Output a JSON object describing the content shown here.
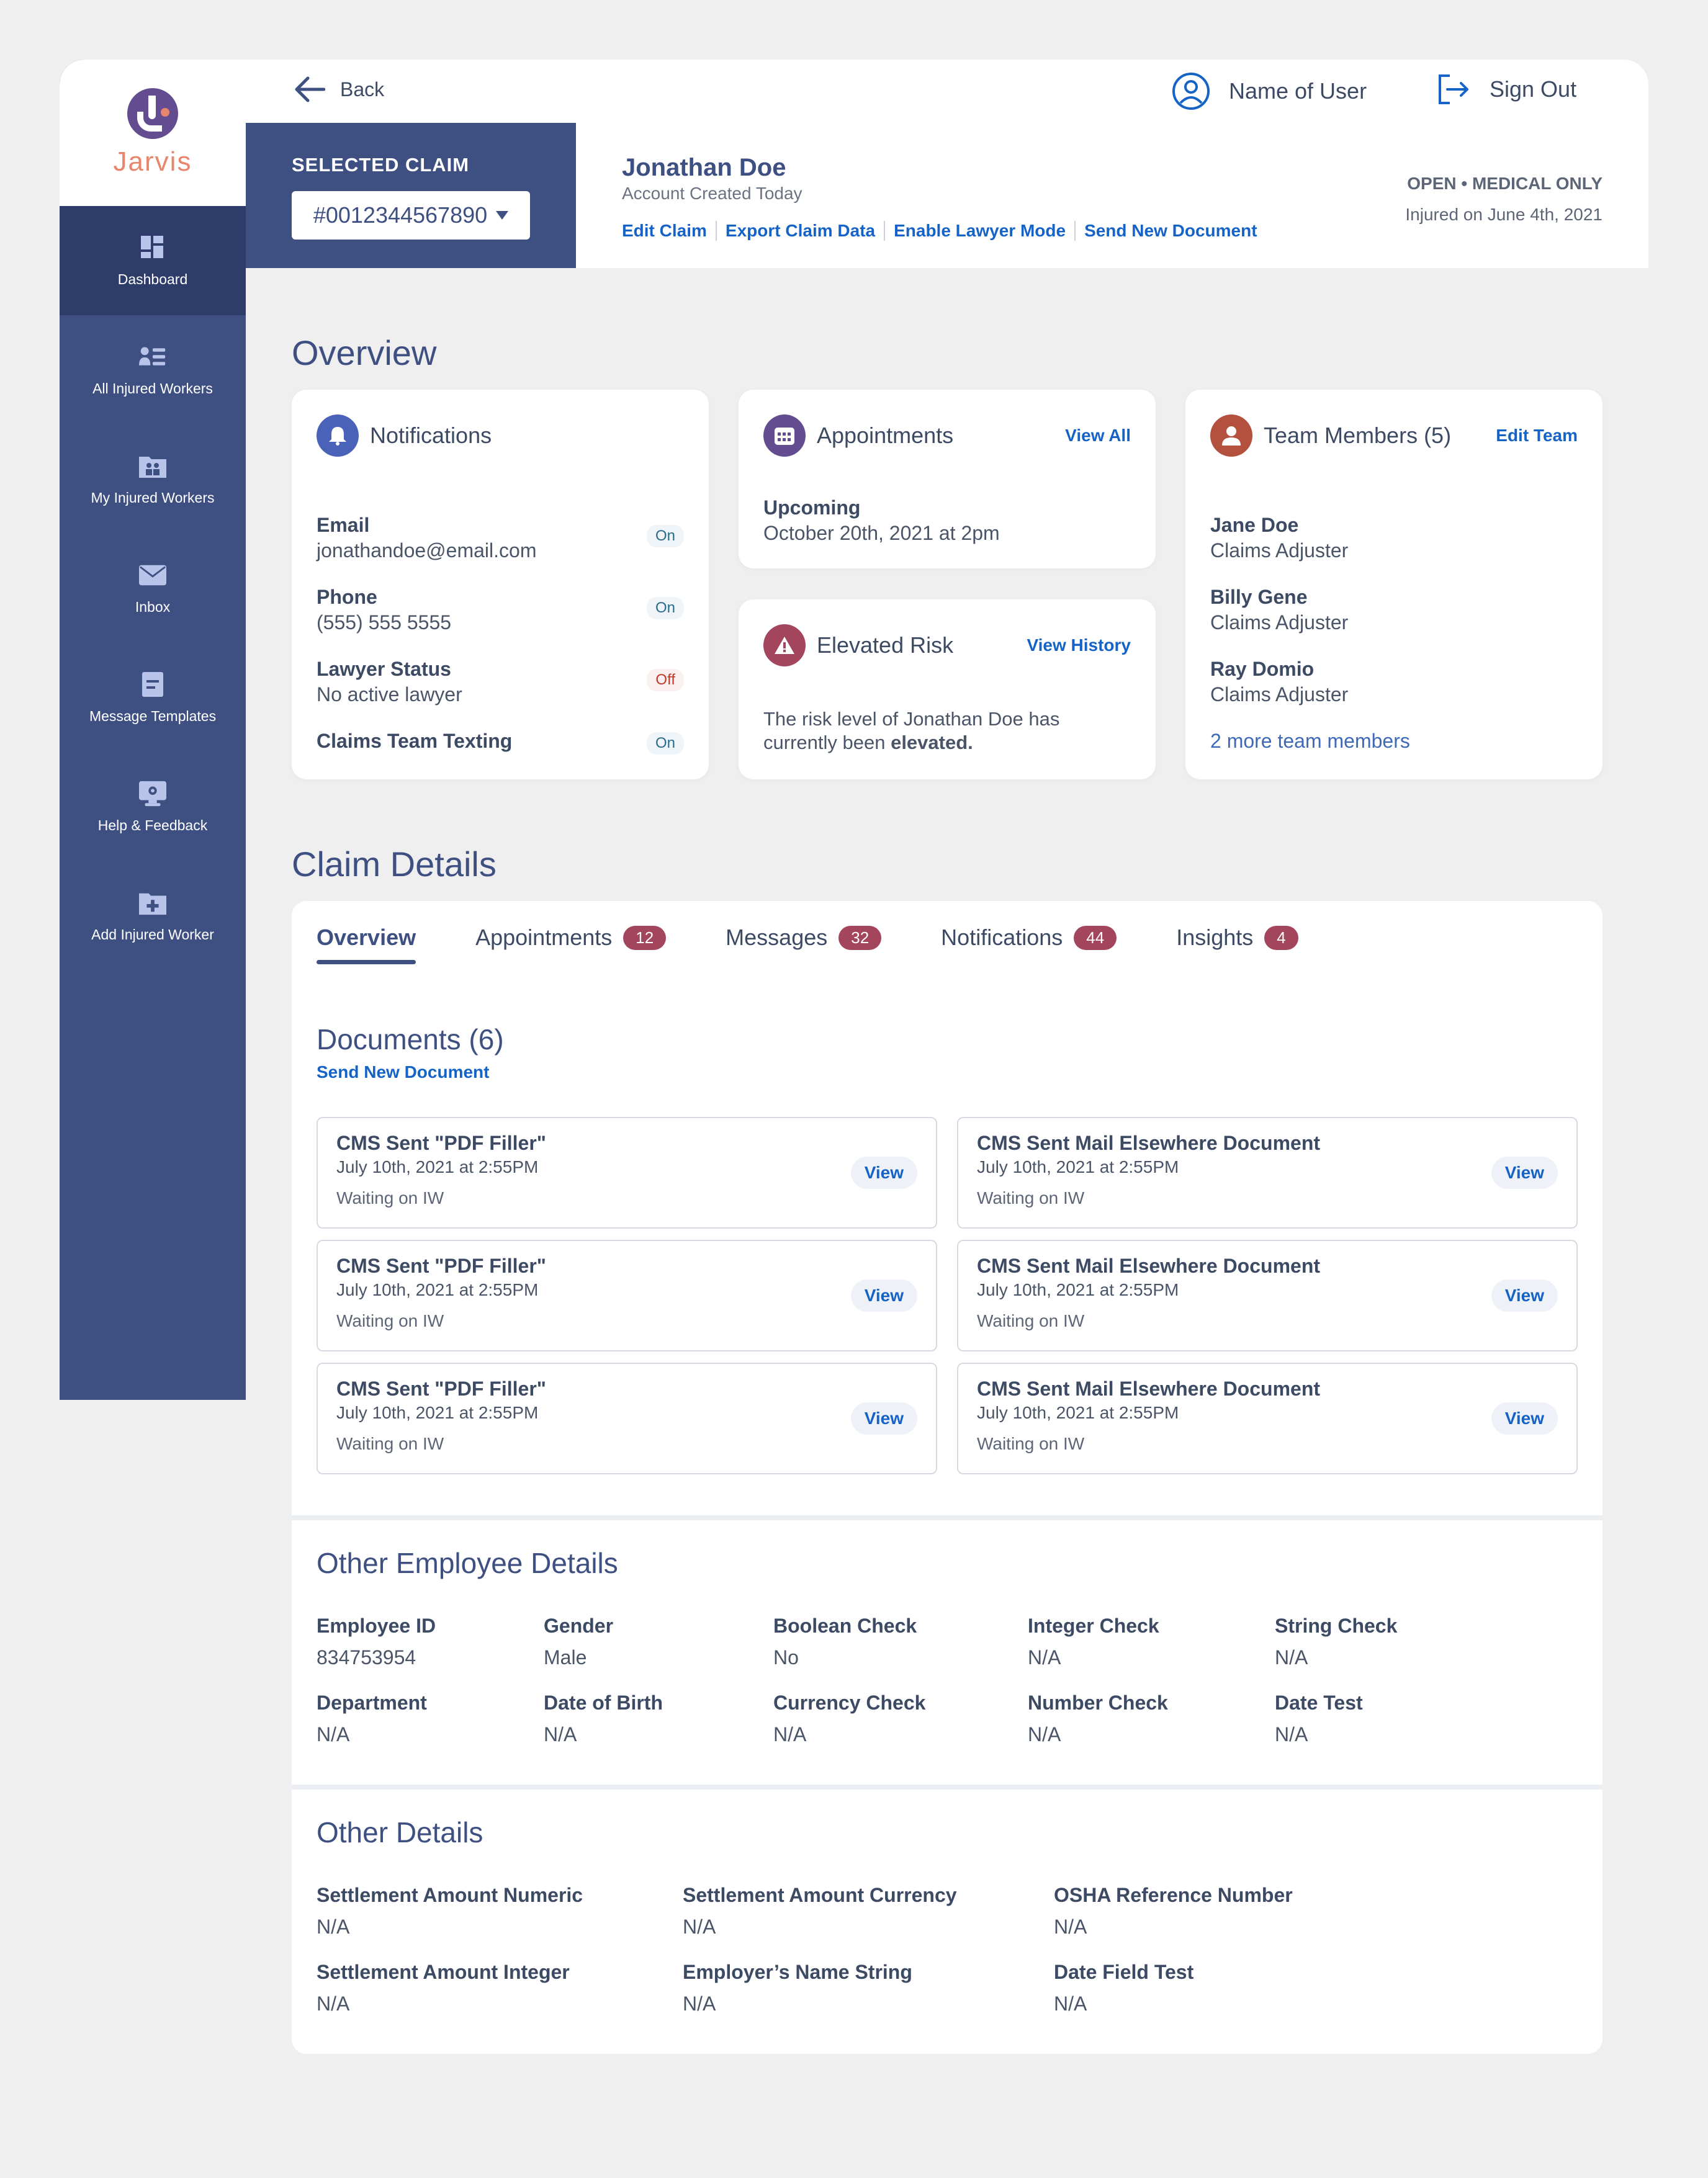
{
  "app": {
    "logo_text": "Jarvis"
  },
  "sidebar": {
    "items": [
      {
        "label": "Dashboard",
        "icon": "dashboard-icon"
      },
      {
        "label": "All Injured Workers",
        "icon": "people-list-icon"
      },
      {
        "label": "My Injured Workers",
        "icon": "folder-people-icon"
      },
      {
        "label": "Inbox",
        "icon": "mail-icon"
      },
      {
        "label": "Message Templates",
        "icon": "document-icon"
      },
      {
        "label": "Help & Feedback",
        "icon": "monitor-gear-icon"
      },
      {
        "label": "Add Injured Worker",
        "icon": "folder-plus-icon"
      }
    ]
  },
  "topbar": {
    "back": "Back",
    "user": "Name of User",
    "sign_out": "Sign Out"
  },
  "claim": {
    "selected_label": "SELECTED CLAIM",
    "number": "#0012344567890",
    "name": "Jonathan Doe",
    "sub": "Account Created Today",
    "links": [
      "Edit Claim",
      "Export Claim Data",
      "Enable Lawyer Mode",
      "Send New Document"
    ],
    "status": "OPEN • MEDICAL ONLY",
    "injured": "Injured on June 4th, 2021"
  },
  "overview": {
    "title": "Overview",
    "notifications": {
      "title": "Notifications",
      "rows": [
        {
          "label": "Email",
          "value": "jonathandoe@email.com",
          "state": "On"
        },
        {
          "label": "Phone",
          "value": "(555) 555 5555",
          "state": "On"
        },
        {
          "label": "Lawyer Status",
          "value": "No active lawyer",
          "state": "Off"
        },
        {
          "label": "Claims Team Texting",
          "value": "",
          "state": "On"
        }
      ]
    },
    "appointments": {
      "title": "Appointments",
      "link": "View All",
      "label": "Upcoming",
      "value": "October 20th, 2021 at 2pm"
    },
    "risk": {
      "title": "Elevated Risk",
      "link": "View History",
      "text": "The risk level of Jonathan Doe has currently been",
      "emphasis": "elevated."
    },
    "team": {
      "title": "Team Members (5)",
      "link": "Edit Team",
      "members": [
        {
          "name": "Jane Doe",
          "role": "Claims Adjuster"
        },
        {
          "name": "Billy Gene",
          "role": "Claims Adjuster"
        },
        {
          "name": "Ray Domio",
          "role": "Claims Adjuster"
        }
      ],
      "more": "2 more team members"
    }
  },
  "claim_details": {
    "title": "Claim Details",
    "tabs": [
      {
        "label": "Overview",
        "badge": null
      },
      {
        "label": "Appointments",
        "badge": "12"
      },
      {
        "label": "Messages",
        "badge": "32"
      },
      {
        "label": "Notifications",
        "badge": "44"
      },
      {
        "label": "Insights",
        "badge": "4"
      }
    ],
    "documents_title": "Documents (6)",
    "documents_link": "Send New Document",
    "view_label": "View",
    "documents": [
      {
        "title": "CMS Sent \"PDF Filler\"",
        "date": "July 10th, 2021 at 2:55PM",
        "status": "Waiting on IW"
      },
      {
        "title": "CMS Sent Mail Elsewhere Document",
        "date": "July 10th, 2021 at 2:55PM",
        "status": "Waiting on IW"
      },
      {
        "title": "CMS Sent \"PDF Filler\"",
        "date": "July 10th, 2021 at 2:55PM",
        "status": "Waiting on IW"
      },
      {
        "title": "CMS Sent Mail Elsewhere Document",
        "date": "July 10th, 2021 at 2:55PM",
        "status": "Waiting on IW"
      },
      {
        "title": "CMS Sent \"PDF Filler\"",
        "date": "July 10th, 2021 at 2:55PM",
        "status": "Waiting on IW"
      },
      {
        "title": "CMS Sent Mail Elsewhere Document",
        "date": "July 10th, 2021 at 2:55PM",
        "status": "Waiting on IW"
      }
    ],
    "employee_title": "Other Employee Details",
    "employee_fields": [
      {
        "label": "Employee ID",
        "value": "834753954"
      },
      {
        "label": "Gender",
        "value": "Male"
      },
      {
        "label": "Boolean Check",
        "value": "No"
      },
      {
        "label": "Integer Check",
        "value": "N/A"
      },
      {
        "label": "String Check",
        "value": "N/A"
      },
      {
        "label": "Department",
        "value": "N/A"
      },
      {
        "label": "Date of Birth",
        "value": "N/A"
      },
      {
        "label": "Currency Check",
        "value": "N/A"
      },
      {
        "label": "Number Check",
        "value": "N/A"
      },
      {
        "label": "Date Test",
        "value": "N/A"
      }
    ],
    "other_title": "Other Details",
    "other_fields": [
      {
        "label": "Settlement Amount Numeric",
        "value": "N/A"
      },
      {
        "label": "Settlement Amount Currency",
        "value": "N/A"
      },
      {
        "label": "OSHA Reference Number",
        "value": "N/A"
      },
      {
        "label": "Settlement Amount Integer",
        "value": "N/A"
      },
      {
        "label": "Employer’s Name String",
        "value": "N/A"
      },
      {
        "label": "Date Field Test",
        "value": "N/A"
      }
    ]
  },
  "colors": {
    "primary": "#3e4f82",
    "link": "#1663c7",
    "badge": "#a3455d",
    "logo_accent": "#e8866d",
    "logo_mark": "#634c8f"
  }
}
